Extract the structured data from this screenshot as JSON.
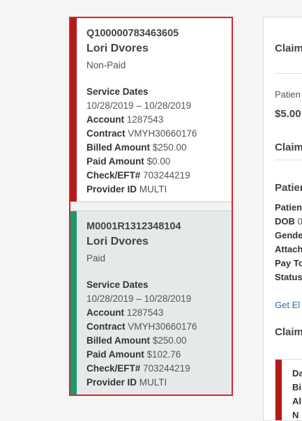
{
  "claims": [
    {
      "id": "Q100000783463605",
      "patient": "Lori Dvores",
      "status": "Non-Paid",
      "service_dates_label": "Service Dates",
      "service_dates": "10/28/2019 – 10/28/2019",
      "account_label": "Account",
      "account": "1287543",
      "contract_label": "Contract",
      "contract": "VMYH30660176",
      "billed_label": "Billed Amount",
      "billed": "$250.00",
      "paid_label": "Paid Amount",
      "paid": "$0.00",
      "check_label": "Check/EFT#",
      "check": "703244219",
      "provider_label": "Provider ID",
      "provider": "MULTI",
      "stripe_color": "#b51a1a"
    },
    {
      "id": "M0001R1312348104",
      "patient": "Lori Dvores",
      "status": "Paid",
      "service_dates_label": "Service Dates",
      "service_dates": "10/28/2019 – 10/28/2019",
      "account_label": "Account",
      "account": "1287543",
      "contract_label": "Contract",
      "contract": "VMYH30660176",
      "billed_label": "Billed Amount",
      "billed": "$250.00",
      "paid_label": "Paid Amount",
      "paid": "$102.76",
      "check_label": "Check/EFT#",
      "check": "703244219",
      "provider_label": "Provider ID",
      "provider": "MULTI",
      "stripe_color": "#1a9a6b"
    }
  ],
  "detail": {
    "heading1": "Claim",
    "patient_resp_label": "Patien",
    "patient_resp_amount": "$5.00",
    "heading2": "Claim",
    "heading3": "Patien",
    "labels": [
      "Patien",
      "DOB",
      "Gende",
      "Attach",
      "Pay To",
      "Status"
    ],
    "dob_value": "0",
    "link": "Get El",
    "heading4": "Claim",
    "mini_lines": [
      "Da",
      "Bi",
      "Al",
      "N"
    ]
  },
  "colors": {
    "selection_border": "#d9252b",
    "non_paid": "#b51a1a",
    "paid": "#1a9a6b",
    "link": "#2a6db5"
  }
}
